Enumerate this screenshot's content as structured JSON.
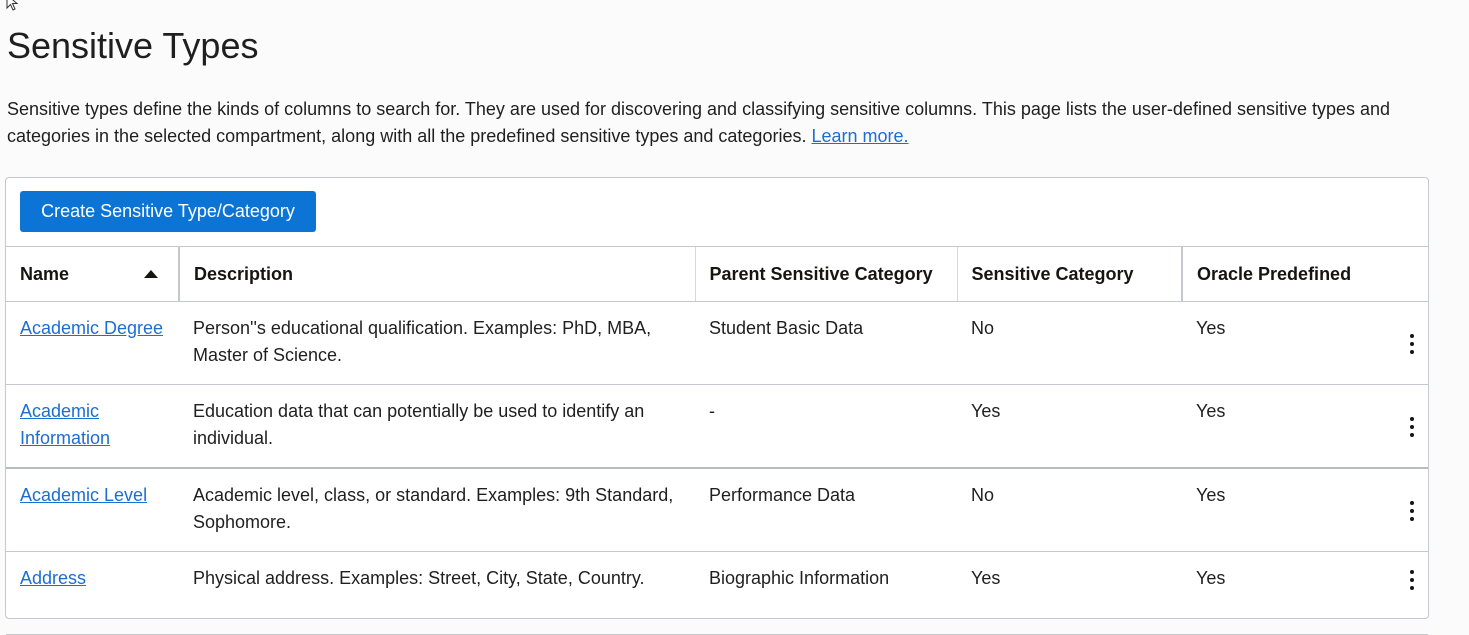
{
  "page": {
    "title": "Sensitive Types",
    "intro_text": "Sensitive types define the kinds of columns to search for. They are used for discovering and classifying sensitive columns. This page lists the user-defined sensitive types and categories in the selected compartment, along with all the predefined sensitive types and categories.",
    "learn_more_label": "Learn more."
  },
  "toolbar": {
    "create_label": "Create Sensitive Type/Category"
  },
  "colors": {
    "primary_button": "#0c74d5",
    "link": "#1a6fd1"
  },
  "table": {
    "columns": [
      {
        "label": "Name",
        "sort": "ascending"
      },
      {
        "label": "Description"
      },
      {
        "label": "Parent Sensitive Category"
      },
      {
        "label": "Sensitive Category"
      },
      {
        "label": "Oracle Predefined"
      }
    ],
    "rows": [
      {
        "name": "Academic Degree",
        "description": "Person''s educational qualification. Examples: PhD, MBA, Master of Science.",
        "parent": "Student Basic Data",
        "is_category": "No",
        "predefined": "Yes"
      },
      {
        "name": "Academic Information",
        "description": "Education data that can potentially be used to identify an individual.",
        "parent": "-",
        "is_category": "Yes",
        "predefined": "Yes"
      },
      {
        "name": "Academic Level",
        "description": "Academic level, class, or standard. Examples: 9th Standard, Sophomore.",
        "parent": "Performance Data",
        "is_category": "No",
        "predefined": "Yes"
      },
      {
        "name": "Address",
        "description": "Physical address. Examples: Street, City, State, Country.",
        "parent": "Biographic Information",
        "is_category": "Yes",
        "predefined": "Yes"
      }
    ]
  }
}
